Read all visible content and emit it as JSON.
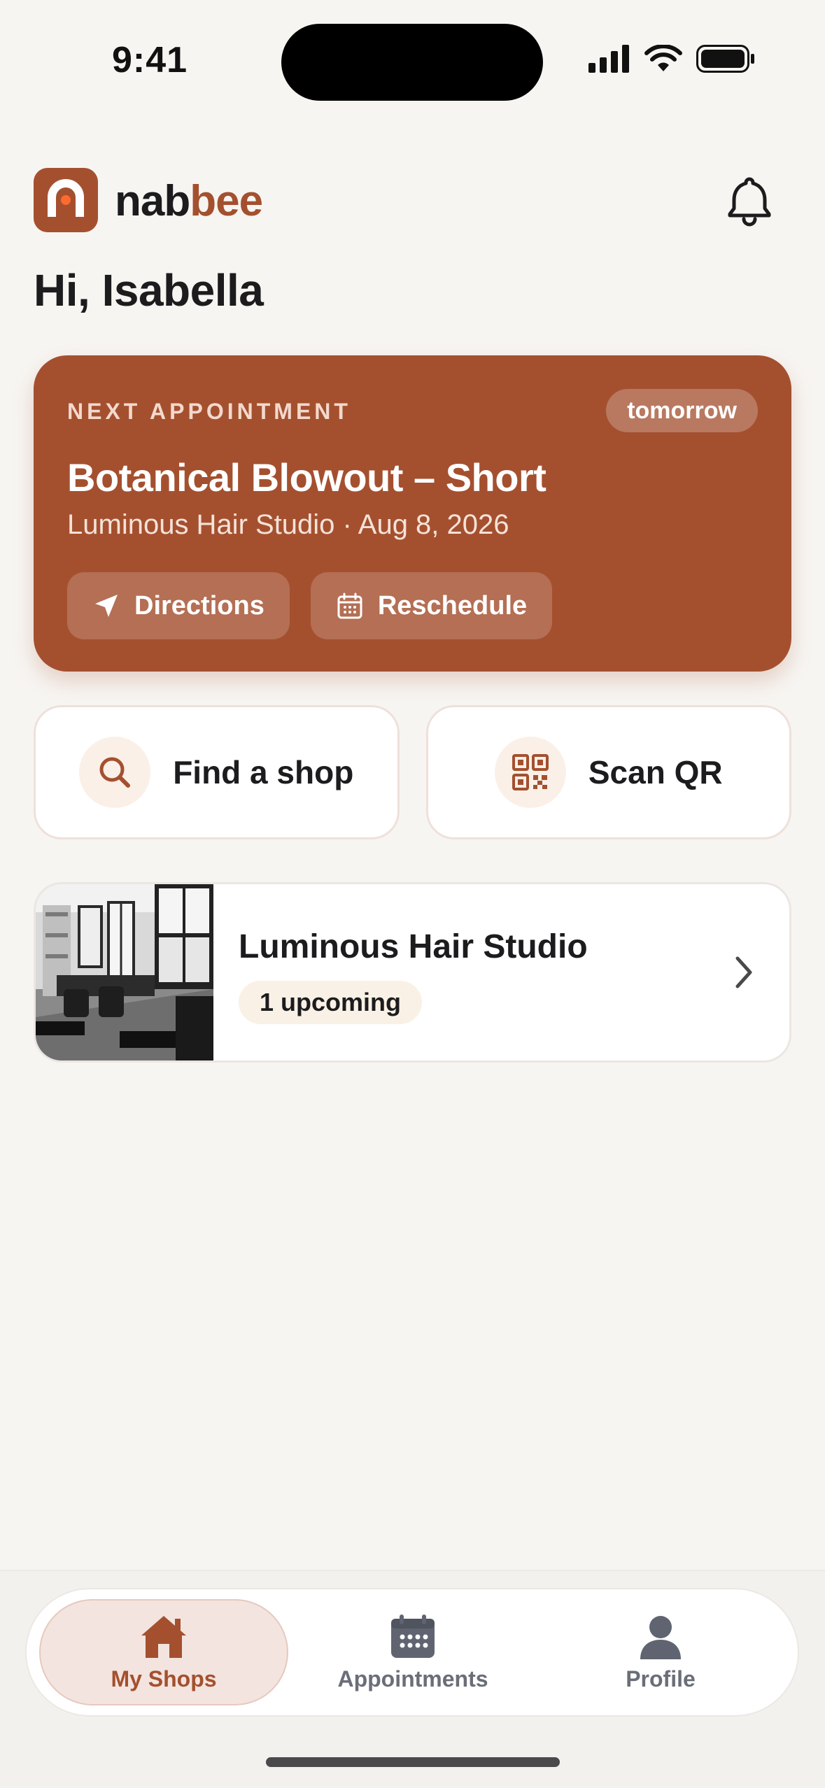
{
  "status_bar": {
    "time": "9:41"
  },
  "header": {
    "brand_part1": "nab",
    "brand_part2": "bee",
    "greeting": "Hi, Isabella"
  },
  "next_appointment": {
    "label": "NEXT APPOINTMENT",
    "badge": "tomorrow",
    "service": "Botanical Blowout – Short",
    "details": "Luminous Hair Studio · Aug 8, 2026",
    "actions": {
      "directions": "Directions",
      "reschedule": "Reschedule"
    }
  },
  "quick_actions": {
    "find_shop": "Find a shop",
    "scan_qr": "Scan QR"
  },
  "shops": [
    {
      "name": "Luminous Hair Studio",
      "badge": "1 upcoming"
    }
  ],
  "tabs": [
    {
      "label": "My Shops",
      "active": true
    },
    {
      "label": "Appointments",
      "active": false
    },
    {
      "label": "Profile",
      "active": false
    }
  ],
  "colors": {
    "brand": "#a4502f",
    "background": "#f7f5f2",
    "inactive_tab": "#6a6e78"
  }
}
